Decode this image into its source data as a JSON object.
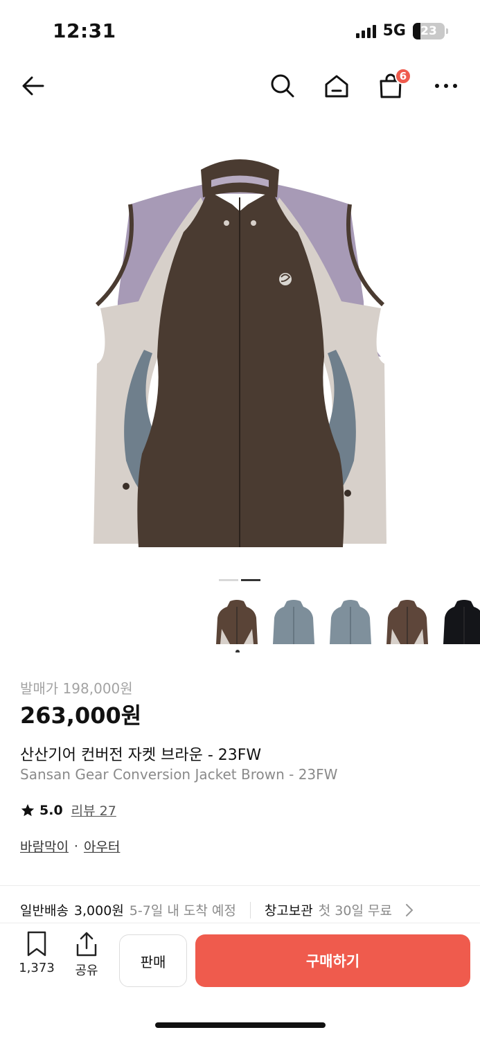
{
  "status_bar": {
    "time": "12:31",
    "network": "5G",
    "battery": "23",
    "battery_level_percent": 23
  },
  "nav": {
    "back_icon": "arrow-left-icon",
    "search_icon": "search-icon",
    "home_icon": "home-icon",
    "cart_icon": "shopping-bag-icon",
    "cart_count": "6",
    "more_icon": "more-horizontal-icon"
  },
  "gallery": {
    "current_page": 2,
    "total_pages": 2
  },
  "color_options": [
    {
      "name": "brown",
      "color": "#5a4437"
    },
    {
      "name": "blue-gray",
      "color": "#7d8e9a"
    },
    {
      "name": "blue-gray-2",
      "color": "#7f909c"
    },
    {
      "name": "brown-2",
      "color": "#5e463a"
    },
    {
      "name": "black",
      "color": "#141519"
    }
  ],
  "product": {
    "release_price": "발매가 198,000원",
    "price": "263,000원",
    "name_ko": "산산기어 컨버전 자켓 브라운 - 23FW",
    "name_en": "Sansan Gear Conversion Jacket Brown - 23FW",
    "rating": "5.0",
    "review_label": "리뷰 27",
    "category_1": "바람막이",
    "category_separator": "·",
    "category_2": "아우터"
  },
  "shipping": {
    "standard_label": "일반배송",
    "standard_fee": "3,000원",
    "standard_eta": "5-7일 내 도착 예정",
    "storage_label": "창고보관",
    "storage_offer": "첫 30일 무료"
  },
  "bottom_bar": {
    "bookmark_count": "1,373",
    "share_label": "공유",
    "sell_label": "판매",
    "buy_label": "구매하기"
  },
  "colors": {
    "accent": "#ef5b4d",
    "text_muted": "#8a8a8a"
  }
}
